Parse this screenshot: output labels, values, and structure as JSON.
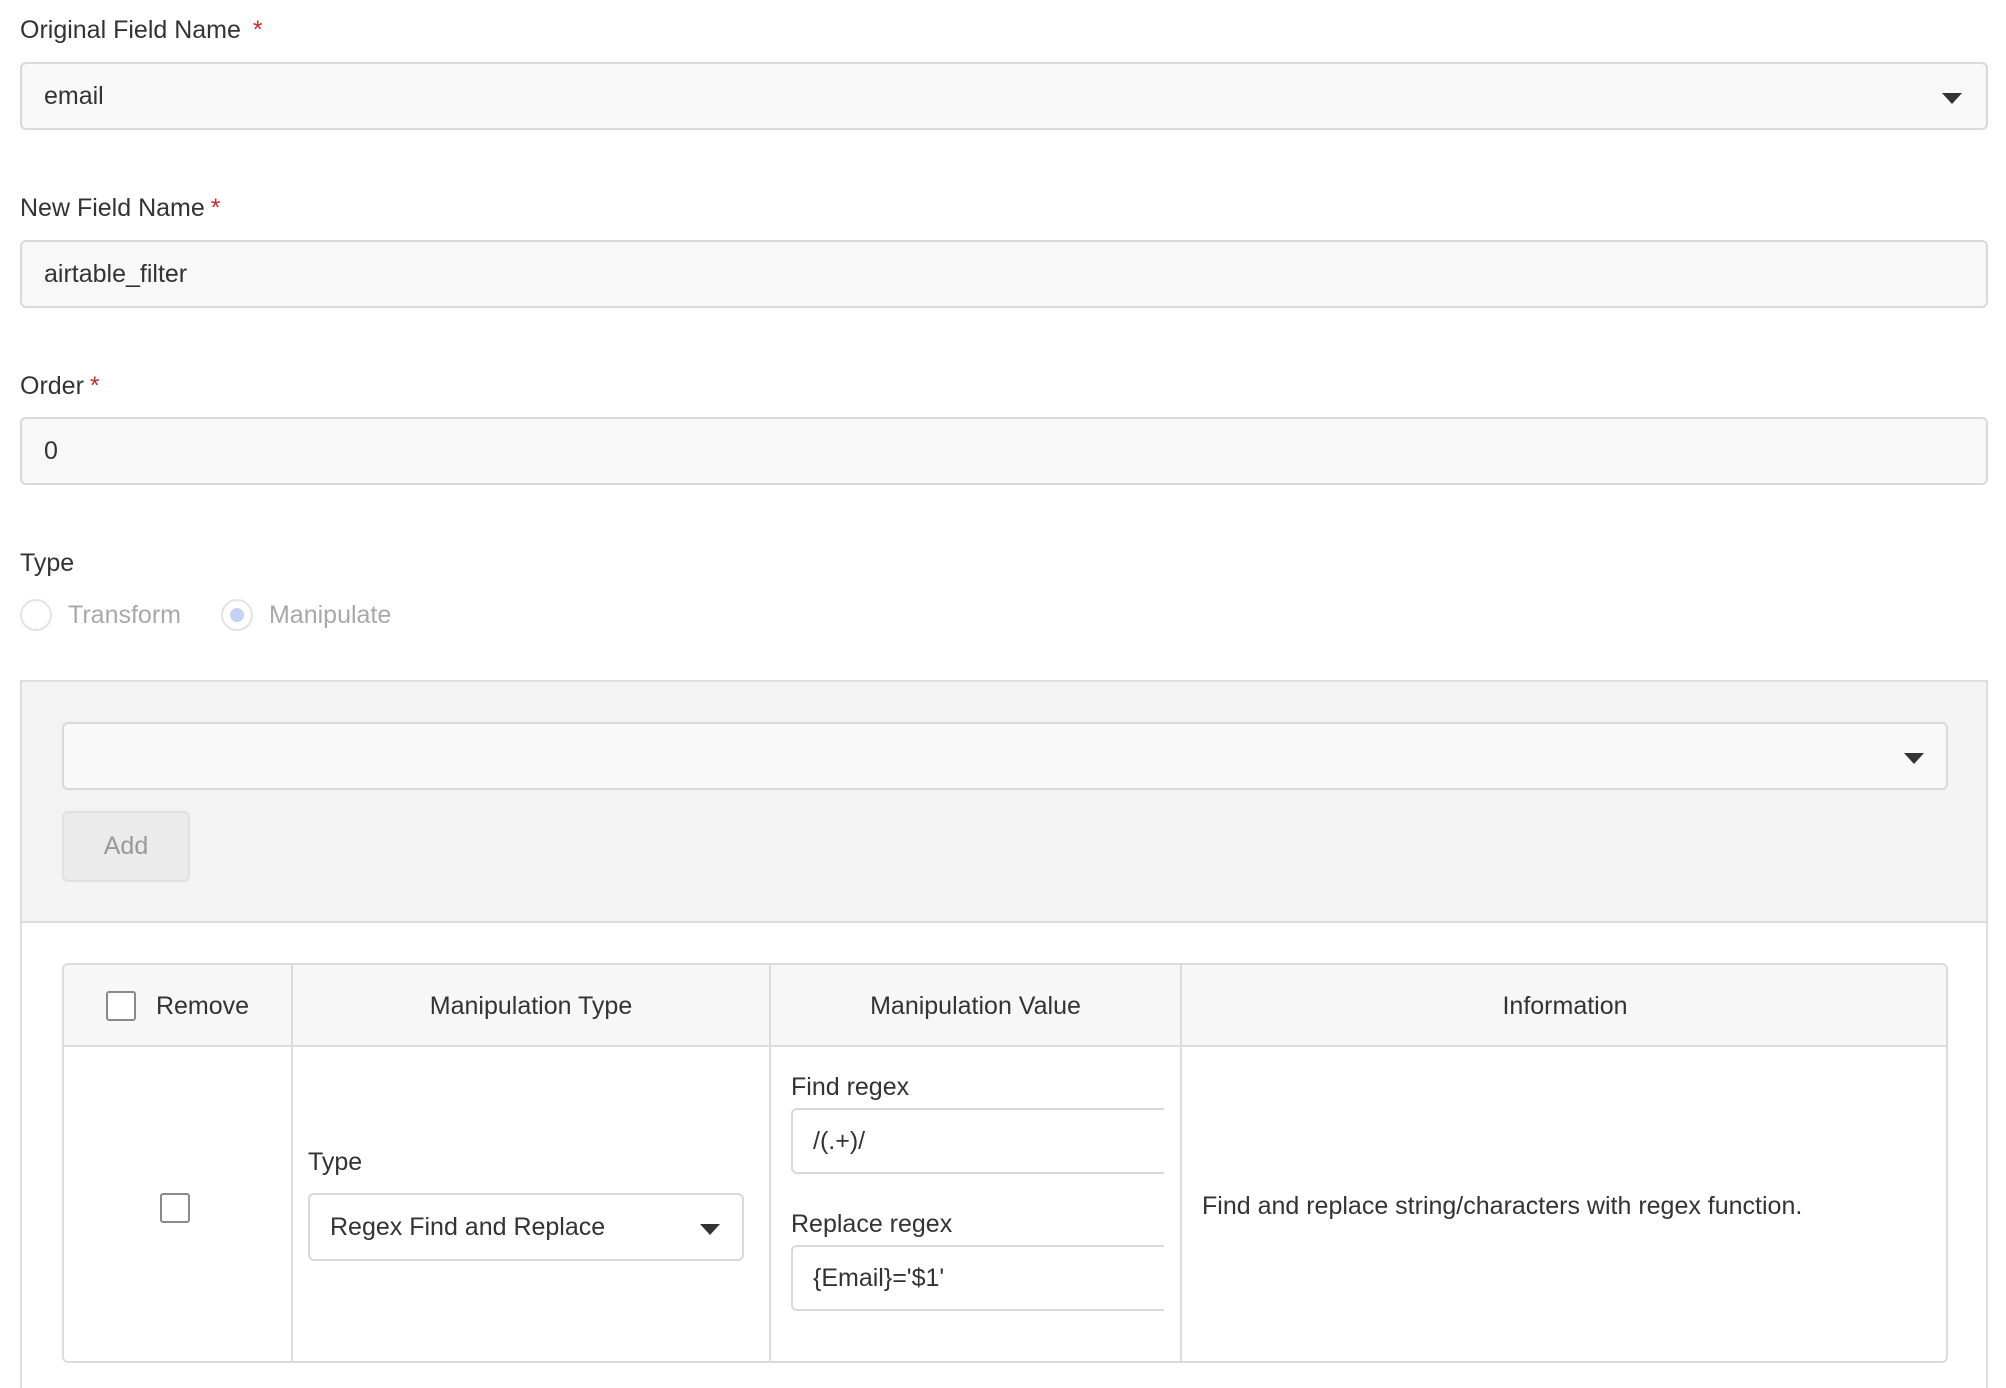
{
  "form": {
    "original_field": {
      "label": "Original Field Name",
      "required_mark": "*",
      "value": "email"
    },
    "new_field": {
      "label": "New Field Name",
      "required_mark": "*",
      "value": "airtable_filter"
    },
    "order": {
      "label": "Order",
      "required_mark": "*",
      "value": "0"
    },
    "type": {
      "label": "Type",
      "options": [
        {
          "label": "Transform",
          "checked": false
        },
        {
          "label": "Manipulate",
          "checked": true
        }
      ]
    }
  },
  "manipulation_panel": {
    "select_value": "",
    "add_label": "Add"
  },
  "table": {
    "headers": {
      "remove": "Remove",
      "manipulation_type": "Manipulation Type",
      "manipulation_value": "Manipulation Value",
      "information": "Information"
    },
    "row": {
      "type_label": "Type",
      "type_value": "Regex Find and Replace",
      "find_label": "Find regex",
      "find_value": "/(.+)/",
      "replace_label": "Replace regex",
      "replace_value": "{Email}='$1'",
      "information": "Find and replace string/characters with regex function."
    }
  },
  "colors": {
    "required": "#cc2b2b",
    "radio_checked": "#c3d2f5",
    "disabled_text": "#a8a8a8"
  }
}
